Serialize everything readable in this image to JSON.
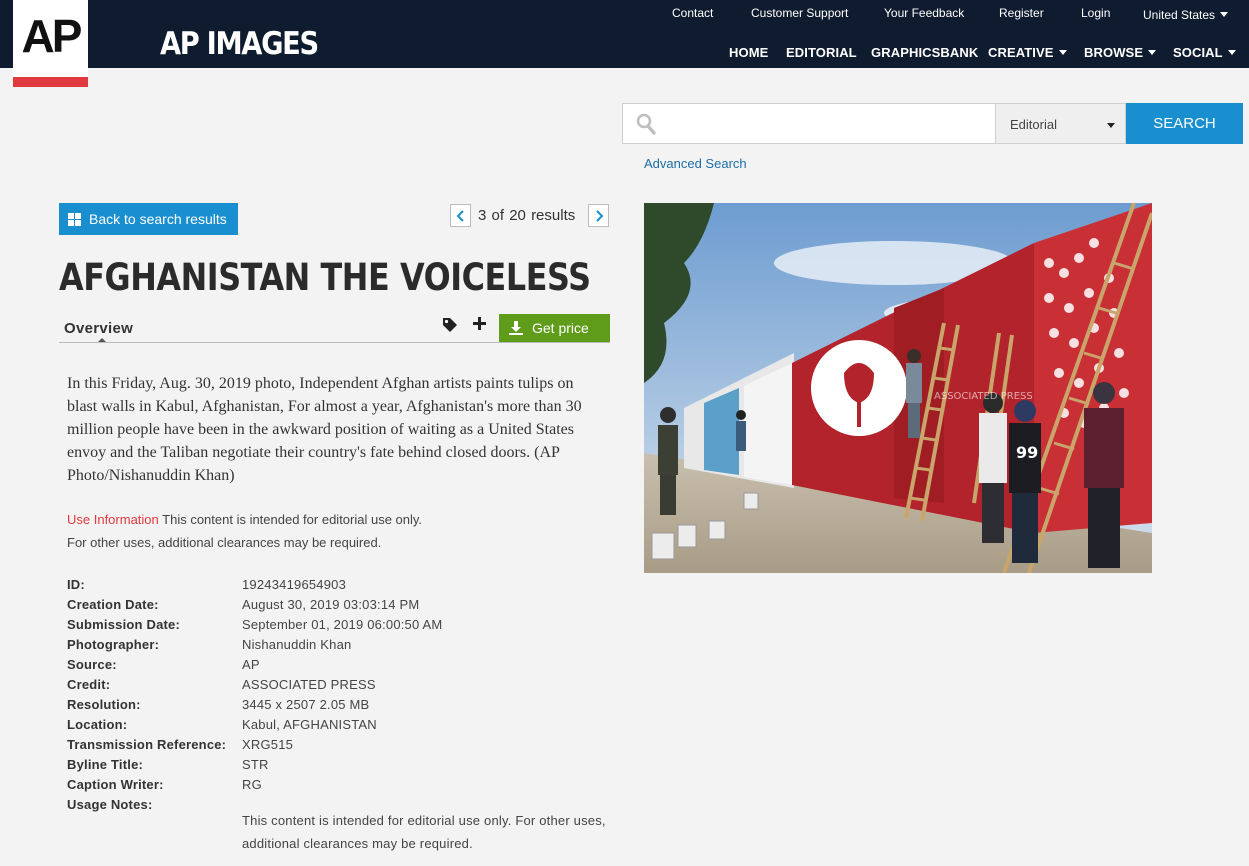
{
  "header": {
    "logo_text": "AP",
    "brand": "AP IMAGES",
    "utility_links": [
      "Contact",
      "Customer Support",
      "Your Feedback",
      "Register",
      "Login"
    ],
    "region": "United States",
    "nav": {
      "home": "HOME",
      "editorial": "EDITORIAL",
      "graphicsbank": "GRAPHICSBANK",
      "creative": "CREATIVE",
      "browse": "BROWSE",
      "social": "SOCIAL"
    },
    "colors": {
      "bar": "#0f1b2e",
      "accent_red": "#e0393e"
    }
  },
  "search": {
    "value": "",
    "placeholder": "",
    "scope": "Editorial",
    "button": "SEARCH",
    "advanced": "Advanced Search"
  },
  "result": {
    "back_label": "Back to search results",
    "position": "3",
    "of_word": "of",
    "total": "20",
    "results_word": "results",
    "title": "AFGHANISTAN THE VOICELESS",
    "tab_overview": "Overview",
    "get_price": "Get price",
    "caption": "In this Friday, Aug. 30, 2019 photo, Independent Afghan artists paints tulips on blast walls in Kabul, Afghanistan, For almost a year, Afghanistan's more than 30 million people have been in the awkward position of waiting as a United States envoy and the Taliban negotiate their country's fate behind closed doors. (AP Photo/Nishanuddin Khan)",
    "use_info_label": "Use Information",
    "use_info_text1": " This content is intended for editorial use only.",
    "use_info_text2": "For other uses, additional clearances may be required."
  },
  "metadata": [
    {
      "label": "ID:",
      "value": "19243419654903"
    },
    {
      "label": "Creation Date:",
      "value": "August 30, 2019 03:03:14 PM"
    },
    {
      "label": "Submission Date:",
      "value": "September 01, 2019 06:00:50 AM"
    },
    {
      "label": "Photographer:",
      "value": "Nishanuddin Khan"
    },
    {
      "label": "Source:",
      "value": "AP"
    },
    {
      "label": "Credit:",
      "value": "ASSOCIATED PRESS"
    },
    {
      "label": "Resolution:",
      "value": "3445 x 2507 2.05 MB"
    },
    {
      "label": "Location:",
      "value": "Kabul, AFGHANISTAN"
    },
    {
      "label": "Transmission Reference:",
      "value": "XRG515"
    },
    {
      "label": "Byline Title:",
      "value": "STR"
    },
    {
      "label": "Caption Writer:",
      "value": "RG"
    },
    {
      "label": "Usage Notes:",
      "value": ""
    }
  ],
  "usage_notes": "This content is intended for editorial use only. For other uses, additional clearances may be required.",
  "photo": {
    "watermark": "ASSOCIATED PRESS",
    "number": "99"
  }
}
